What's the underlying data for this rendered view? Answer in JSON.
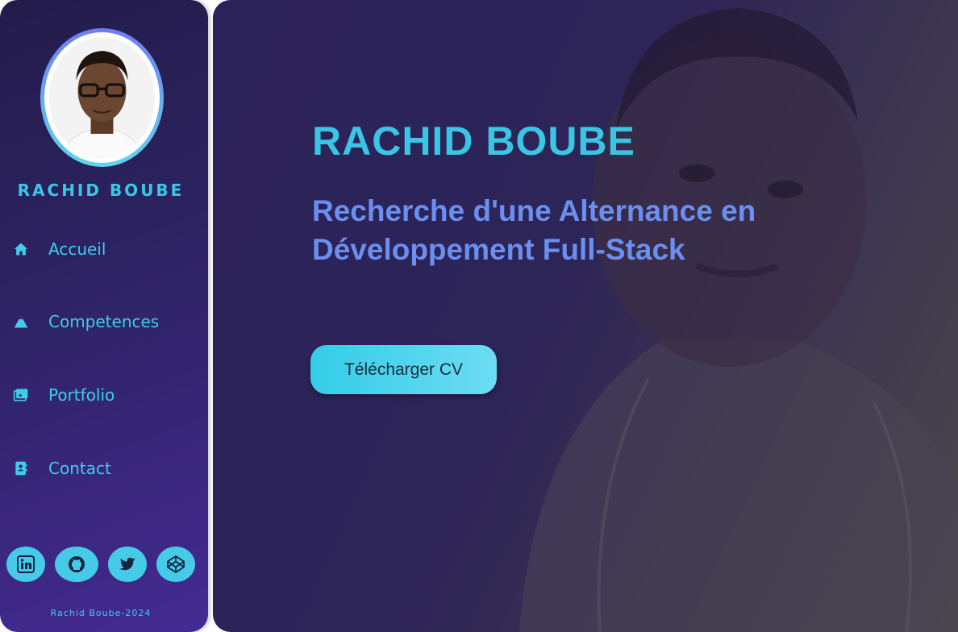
{
  "sidebar": {
    "name": "RACHID BOUBE",
    "nav": [
      {
        "label": "Accueil",
        "icon": "home-icon"
      },
      {
        "label": "Competences",
        "icon": "mountain-icon"
      },
      {
        "label": "Portfolio",
        "icon": "images-icon"
      },
      {
        "label": "Contact",
        "icon": "contact-book-icon"
      }
    ],
    "socials": [
      "linkedin-icon",
      "github-icon",
      "twitter-icon",
      "codepen-icon"
    ],
    "footer": "Rachid Boube-2024"
  },
  "hero": {
    "title": "RACHID BOUBE",
    "subtitle": "Recherche d'une Alternance en Développement Full-Stack",
    "cta": "Télécharger CV"
  },
  "colors": {
    "accent": "#38c6e4",
    "subtitle": "#6b8ff0",
    "sidebar_bg": "#2e2364"
  }
}
